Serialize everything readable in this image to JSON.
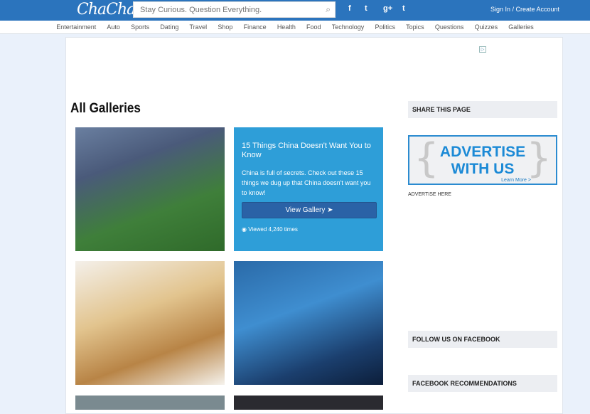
{
  "header": {
    "logo": "ChaCha",
    "search_placeholder": "Stay Curious. Question Everything.",
    "social": [
      "f",
      "t",
      "g+",
      "t"
    ],
    "signin": "Sign In / Create Account"
  },
  "nav": [
    "Entertainment",
    "Auto",
    "Sports",
    "Dating",
    "Travel",
    "Shop",
    "Finance",
    "Health",
    "Food",
    "Technology",
    "Politics",
    "Topics",
    "Questions",
    "Quizzes",
    "Galleries"
  ],
  "page_title": "All Galleries",
  "featured": {
    "title": "15 Things China Doesn't Want You to Know",
    "description": "China is full of secrets. Check out these 15 things we dug up that China doesn't want you to know!",
    "button": "View Gallery",
    "views": "Viewed 4,240 times"
  },
  "sidebar": {
    "share": "SHARE THIS PAGE",
    "ad_line1": "ADVERTISE",
    "ad_line2": "WITH US",
    "learn_more": "Learn More >",
    "advertise_here": "ADVERTISE HERE",
    "follow": "FOLLOW US ON FACEBOOK",
    "recommend": "FACEBOOK RECOMMENDATIONS"
  },
  "colors": {
    "header": "#2b74bd",
    "tile_overlay": "#2e9ed8",
    "button": "#2a62a6",
    "ad_text": "#1c8ad6"
  }
}
